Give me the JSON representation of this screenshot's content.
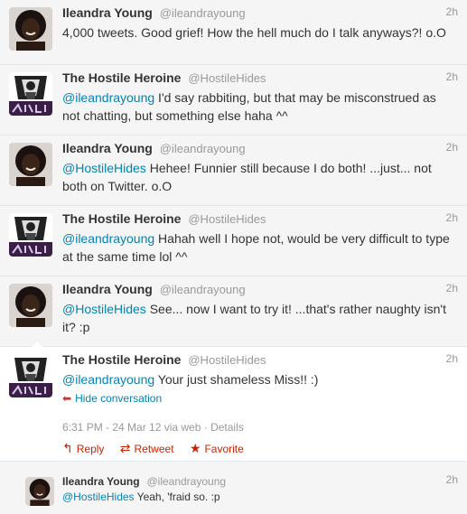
{
  "tweets": [
    {
      "name": "Ileandra Young",
      "handle": "@ileandrayoung",
      "time": "2h",
      "avatar_icon": "ileandra-avatar",
      "mention": "",
      "text": "4,000 tweets. Good grief! How the hell much do I talk anyways?! o.O"
    },
    {
      "name": "The Hostile Heroine",
      "handle": "@HostileHides",
      "time": "2h",
      "avatar_icon": "hostile-heroine-avatar",
      "mention": "@ileandrayoung",
      "text": " I'd say rabbiting, but that may be misconstrued as not chatting, but something else haha ^^"
    },
    {
      "name": "Ileandra Young",
      "handle": "@ileandrayoung",
      "time": "2h",
      "avatar_icon": "ileandra-avatar",
      "mention": "@HostileHides",
      "text": " Hehee! Funnier still because I do both! ...just... not both on Twitter. o.O"
    },
    {
      "name": "The Hostile Heroine",
      "handle": "@HostileHides",
      "time": "2h",
      "avatar_icon": "hostile-heroine-avatar",
      "mention": "@ileandrayoung",
      "text": " Hahah well I hope not, would be very difficult to type at the same time lol ^^"
    },
    {
      "name": "Ileandra Young",
      "handle": "@ileandrayoung",
      "time": "2h",
      "avatar_icon": "ileandra-avatar",
      "mention": "@HostileHides",
      "text": " See... now I want to try it! ...that's rather naughty isn't it? :p"
    }
  ],
  "focused": {
    "name": "The Hostile Heroine",
    "handle": "@HostileHides",
    "time": "2h",
    "mention": "@ileandrayoung",
    "text": " Your just shameless Miss!! :)",
    "hide_conversation": "Hide conversation",
    "timestamp": "6:31 PM - 24 Mar 12 via web",
    "separator": " · ",
    "details": "Details",
    "actions": {
      "reply": "Reply",
      "retweet": "Retweet",
      "favorite": "Favorite"
    }
  },
  "reply": {
    "name": "Ileandra Young",
    "handle": "@ileandrayoung",
    "time": "2h",
    "mention": "@HostileHides",
    "text": " Yeah, 'fraid so. :p"
  },
  "colors": {
    "link": "#0084b4",
    "action": "#cc2200",
    "muted": "#999999"
  }
}
